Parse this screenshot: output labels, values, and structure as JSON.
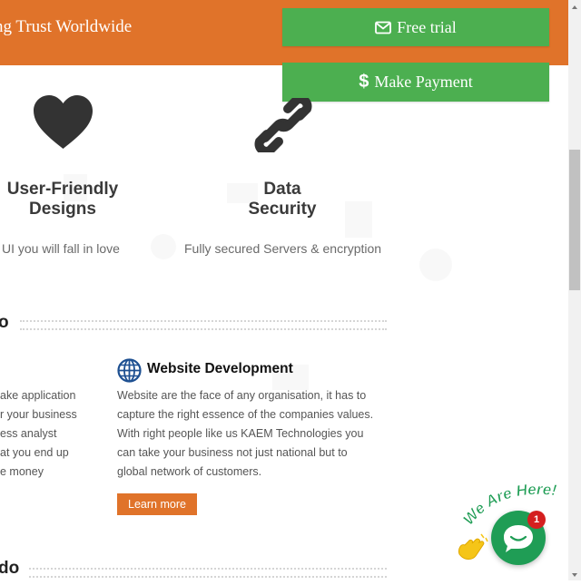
{
  "banner": {
    "text": "ng Trust Worldwide",
    "free_trial_label": "Free trial",
    "make_payment_label": "Make Payment",
    "colors": {
      "banner": "#e0732a",
      "cta": "#4caf50"
    }
  },
  "features": [
    {
      "icon": "heart-icon",
      "title_line1": "User-Friendly",
      "title_line2": "Designs",
      "desc": "UI you will fall in love"
    },
    {
      "icon": "link-icon",
      "title_line1": "Data",
      "title_line2": "Security",
      "desc": "Fully secured Servers & encryption"
    }
  ],
  "section1": {
    "heading": "o",
    "left_lines": [
      "ake application",
      "r your business",
      "ess analyst",
      "at you end up",
      "e money"
    ],
    "service": {
      "icon": "globe-icon",
      "title": "Website Development",
      "desc_lines": [
        "Website are the face of any organisation, it has to",
        "capture the right essence of the companies values.",
        "With right people like us KAEM Technologies you",
        "can take your business not just national but to",
        "global network of customers."
      ],
      "button": "Learn more"
    }
  },
  "section2": {
    "heading": "do"
  },
  "chat": {
    "label": "We Are Here!",
    "badge": "1",
    "color": "#1f9d55"
  }
}
